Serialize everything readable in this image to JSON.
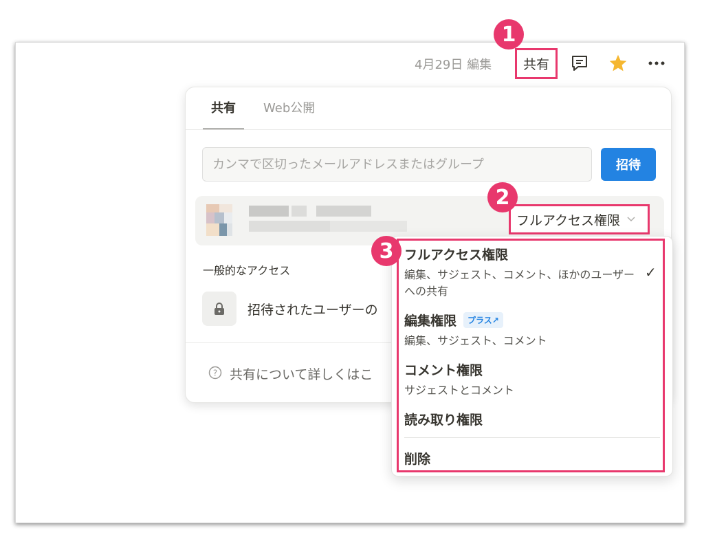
{
  "topbar": {
    "edited": "4月29日 編集",
    "share_label": "共有",
    "icons": {
      "comment": "comment-icon",
      "favorite": "star-icon",
      "more": "more-icon"
    }
  },
  "badges": [
    "1",
    "2",
    "3"
  ],
  "share_panel": {
    "tabs": [
      {
        "label": "共有"
      },
      {
        "label": "Web公開"
      }
    ],
    "invite_placeholder": "カンマで区切ったメールアドレスまたはグループ",
    "invite_button": "招待",
    "member": {
      "permission": "フルアクセス権限"
    },
    "general_access_heading": "一般的なアクセス",
    "general_access_value": "招待されたユーザーの",
    "help_text": "共有について詳しくはこ"
  },
  "permission_menu": {
    "options": [
      {
        "title": "フルアクセス権限",
        "desc": "編集、サジェスト、コメント、ほかのユーザーへの共有",
        "selected": true
      },
      {
        "title": "編集権限",
        "tag": "プラス↗",
        "desc": "編集、サジェスト、コメント"
      },
      {
        "title": "コメント権限",
        "desc": "サジェストとコメント"
      },
      {
        "title": "読み取り権限"
      }
    ],
    "remove": "削除",
    "check": "✓"
  },
  "colors": {
    "accent": "#e8386d",
    "primary": "#2383e2",
    "star": "#f5b731"
  }
}
